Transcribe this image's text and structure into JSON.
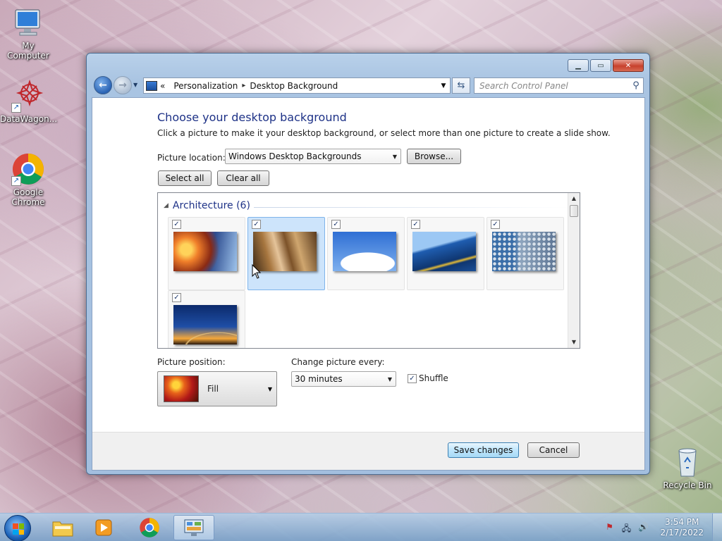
{
  "desktop": {
    "icons": [
      {
        "label": "My Computer"
      },
      {
        "label": "DataWagon..."
      },
      {
        "label": "Google Chrome"
      },
      {
        "label": "Recycle Bin"
      }
    ]
  },
  "window": {
    "title_buttons": {
      "minimize": "▁",
      "maximize": "▭",
      "close": "✕"
    },
    "address": {
      "prefix": "«",
      "crumbs": [
        "Personalization",
        "Desktop Background"
      ],
      "separator": "▸"
    },
    "search": {
      "placeholder": "Search Control Panel"
    },
    "heading": "Choose your desktop background",
    "subtext": "Click a picture to make it your desktop background, or select more than one picture to create a slide show.",
    "picture_location": {
      "label": "Picture location:",
      "value": "Windows Desktop Backgrounds",
      "browse": "Browse..."
    },
    "select_all": "Select all",
    "clear_all": "Clear all",
    "group": {
      "name": "Architecture (6)",
      "pictures": [
        {
          "checked": true,
          "selected": false
        },
        {
          "checked": true,
          "selected": true
        },
        {
          "checked": true,
          "selected": false
        },
        {
          "checked": true,
          "selected": false
        },
        {
          "checked": true,
          "selected": false
        },
        {
          "checked": true,
          "selected": false
        }
      ]
    },
    "picture_position": {
      "label": "Picture position:",
      "value": "Fill"
    },
    "change_every": {
      "label": "Change picture every:",
      "value": "30 minutes"
    },
    "shuffle": {
      "label": "Shuffle",
      "checked": true
    },
    "save": "Save changes",
    "cancel": "Cancel"
  },
  "taskbar": {
    "clock": {
      "time": "3:54 PM",
      "date": "2/17/2022"
    }
  },
  "colors": {
    "heading": "#1e3287",
    "selected_tile": "#cde4fb"
  }
}
